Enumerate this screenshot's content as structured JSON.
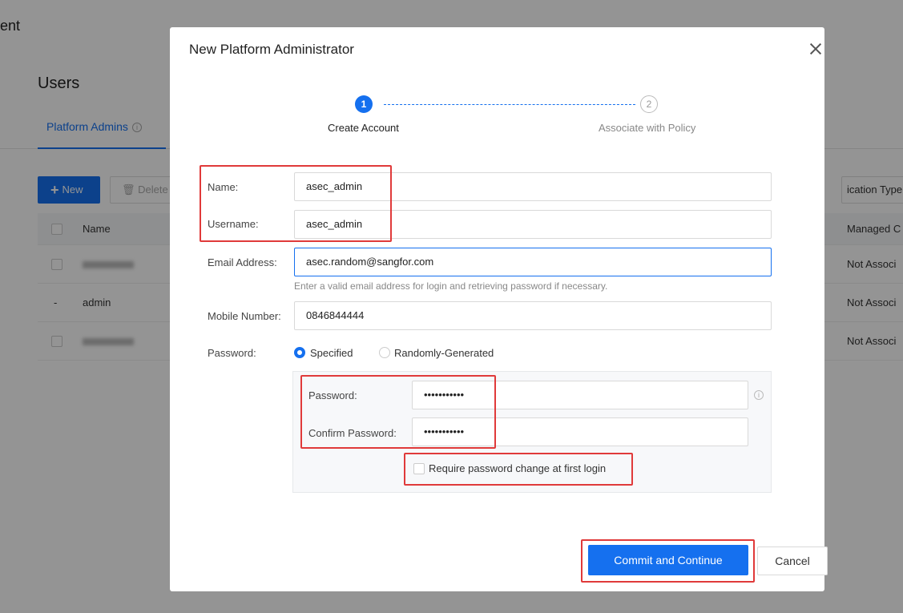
{
  "background": {
    "topbar_text": "ent",
    "title": "Users",
    "tab": {
      "label": "Platform Admins",
      "info": "i"
    },
    "new_button": "New",
    "delete_button": "Delete",
    "right_button": "ication Type",
    "table": {
      "header": {
        "name": "Name",
        "right": "Managed C"
      },
      "rows": [
        {
          "name": "",
          "right": "Not Associ"
        },
        {
          "name": "admin",
          "right": "Not Associ"
        },
        {
          "name": "",
          "right": "Not Associ"
        }
      ]
    }
  },
  "modal": {
    "title": "New Platform Administrator",
    "steps": [
      {
        "number": "1",
        "label": "Create Account"
      },
      {
        "number": "2",
        "label": "Associate with Policy"
      }
    ],
    "fields": {
      "name": {
        "label": "Name:",
        "value": "asec_admin"
      },
      "username": {
        "label": "Username:",
        "value": "asec_admin"
      },
      "email": {
        "label": "Email Address:",
        "value": "asec.random@sangfor.com",
        "hint": "Enter a valid email address for login and retrieving password if necessary."
      },
      "mobile": {
        "label": "Mobile Number:",
        "value": "0846844444"
      },
      "password_mode": {
        "label": "Password:",
        "options": [
          "Specified",
          "Randomly-Generated"
        ]
      },
      "password": {
        "label": "Password:",
        "value": "•••••••••••"
      },
      "confirm_password": {
        "label": "Confirm Password:",
        "value": "•••••••••••"
      },
      "require_change": {
        "label": "Require password change at first login"
      }
    },
    "buttons": {
      "commit": "Commit and Continue",
      "cancel": "Cancel"
    },
    "info_glyph": "i"
  },
  "colors": {
    "accent": "#1570ef",
    "highlight": "#e03a3a"
  }
}
